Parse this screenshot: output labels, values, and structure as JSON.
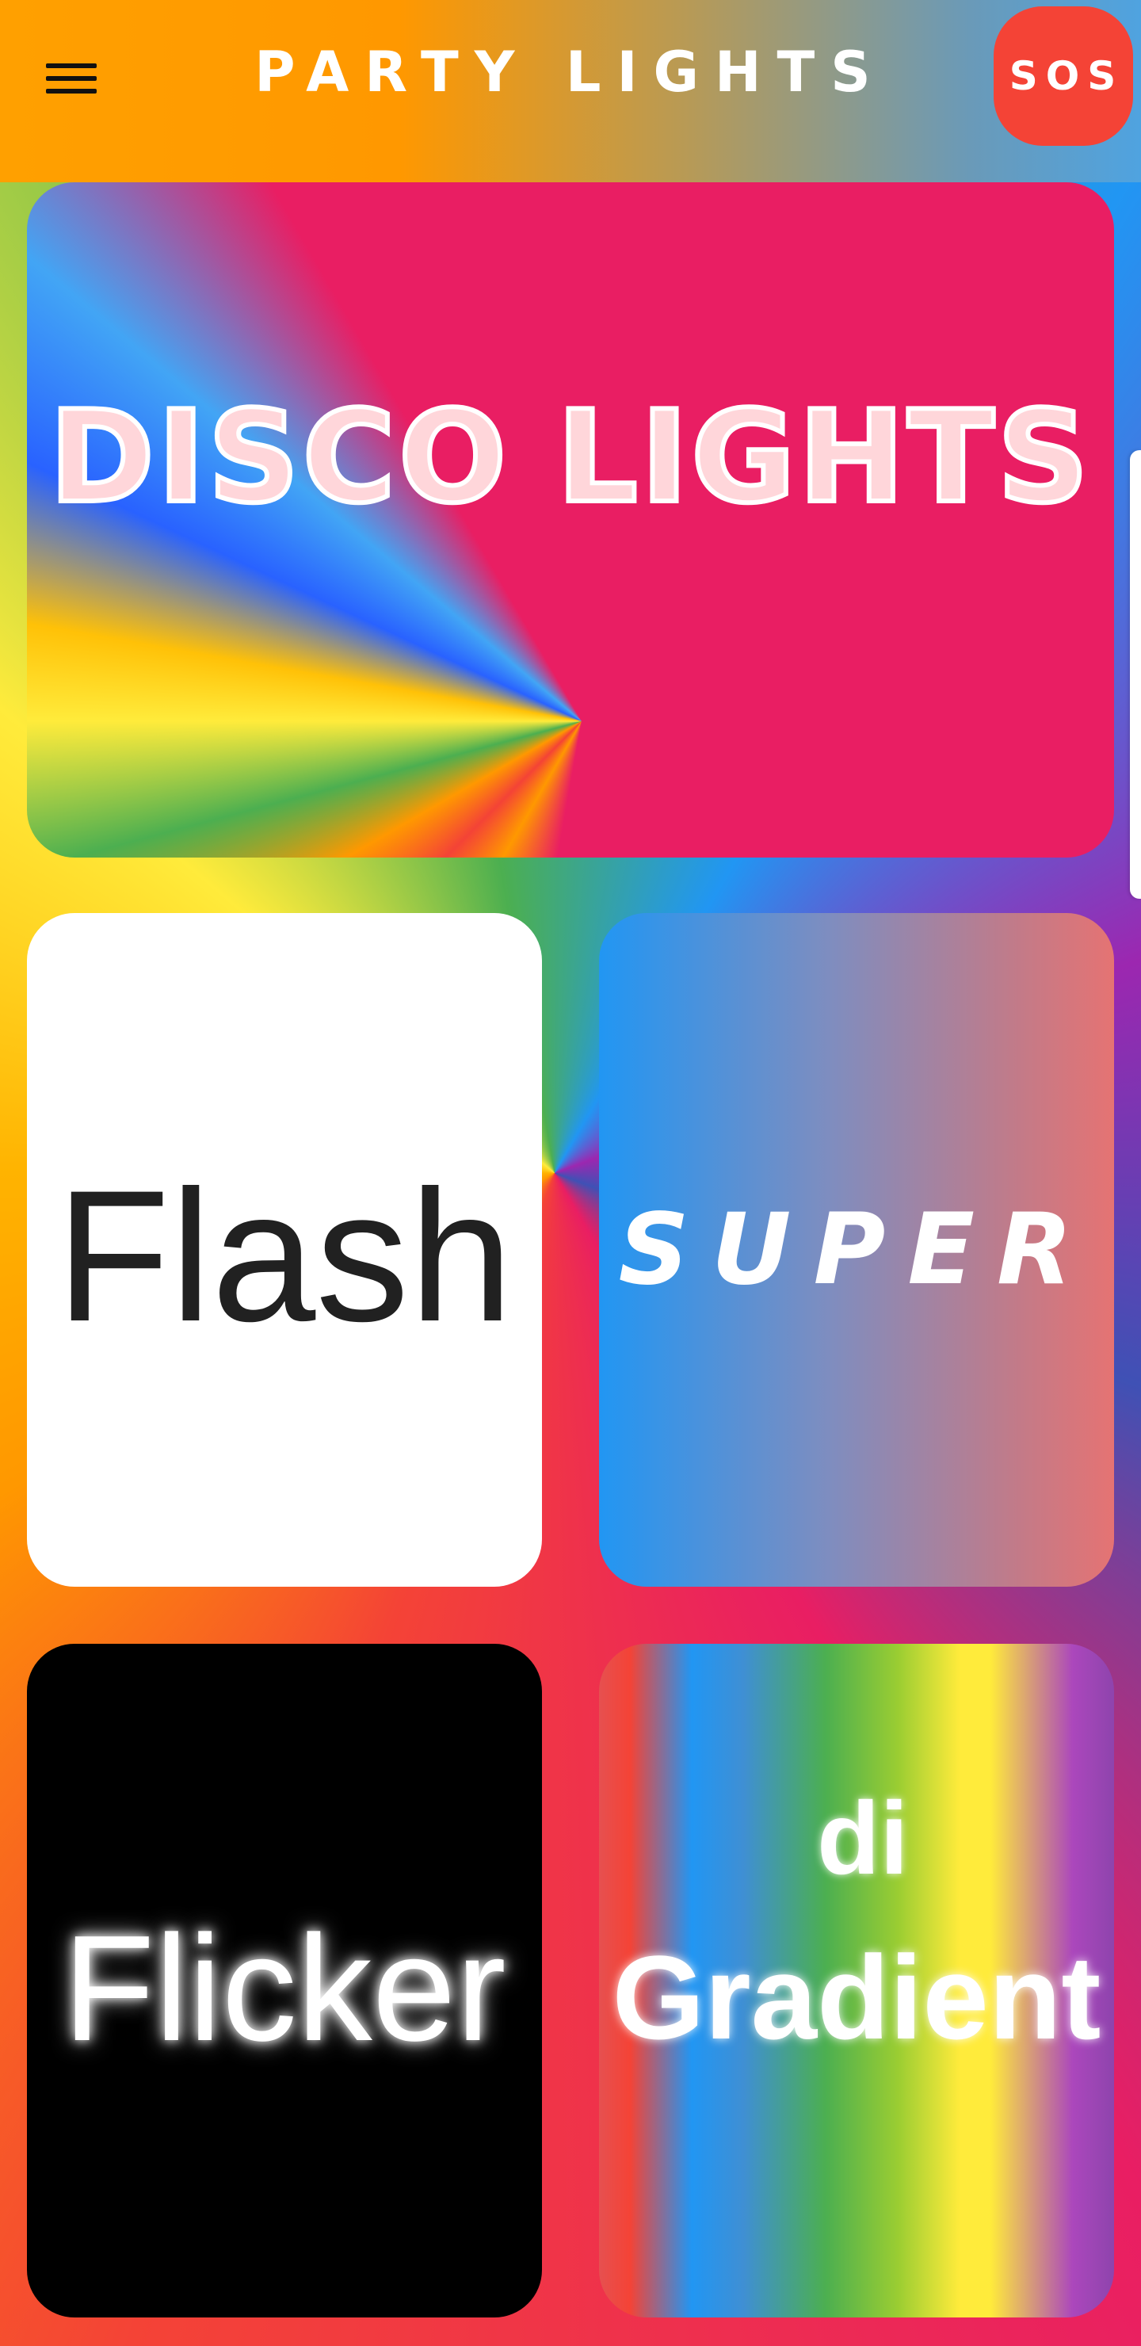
{
  "header": {
    "menu_icon": "hamburger-menu-icon",
    "title": "PARTY LIGHTS",
    "sos_label": "SOS",
    "sos_color": "#f44336"
  },
  "tiles": [
    {
      "id": "disco",
      "label": "DISCO LIGHTS",
      "background": "#e91e63"
    },
    {
      "id": "flash",
      "label": "Flash",
      "background": "#ffffff"
    },
    {
      "id": "super",
      "label": "SUPER",
      "background": "#2196f3"
    },
    {
      "id": "flicker",
      "label": "Flicker",
      "background": "#000000"
    },
    {
      "id": "gradient",
      "label": "Gradient",
      "overlay_text": "di",
      "background": "rainbow"
    }
  ]
}
